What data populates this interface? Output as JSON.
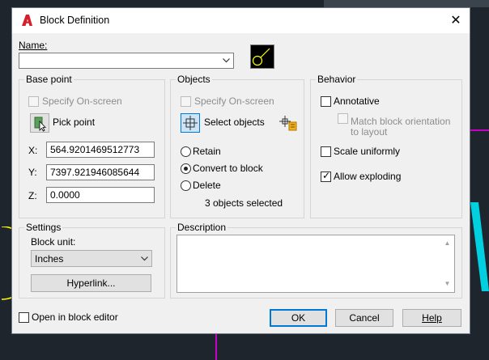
{
  "dialog": {
    "title": "Block Definition",
    "close_glyph": "✕"
  },
  "name": {
    "label": "Name:",
    "value": ""
  },
  "base_point": {
    "legend": "Base point",
    "specify_label": "Specify On-screen",
    "pick_label": "Pick point",
    "x_label": "X:",
    "x_value": "564.9201469512773",
    "y_label": "Y:",
    "y_value": "7397.921946085644",
    "z_label": "Z:",
    "z_value": "0.0000"
  },
  "objects": {
    "legend": "Objects",
    "specify_label": "Specify On-screen",
    "select_label": "Select objects",
    "retain_label": "Retain",
    "convert_label": "Convert to block",
    "delete_label": "Delete",
    "selected_count": "3 objects selected"
  },
  "behavior": {
    "legend": "Behavior",
    "annotative_label": "Annotative",
    "match_label_1": "Match block orientation",
    "match_label_2": "to layout",
    "scale_label": "Scale uniformly",
    "explode_label": "Allow exploding"
  },
  "settings": {
    "legend": "Settings",
    "unit_label": "Block unit:",
    "unit_value": "Inches",
    "hyperlink_label": "Hyperlink..."
  },
  "description": {
    "legend": "Description",
    "value": ""
  },
  "footer": {
    "open_editor_label": "Open in block editor",
    "ok_label": "OK",
    "cancel_label": "Cancel",
    "help_label": "Help"
  },
  "colors": {
    "accent": "#0078d7",
    "autocad_red": "#d4202b",
    "preview_yellow": "#ffff00",
    "magenta_line": "#c800c8",
    "cyan_line": "#00d0e0"
  }
}
